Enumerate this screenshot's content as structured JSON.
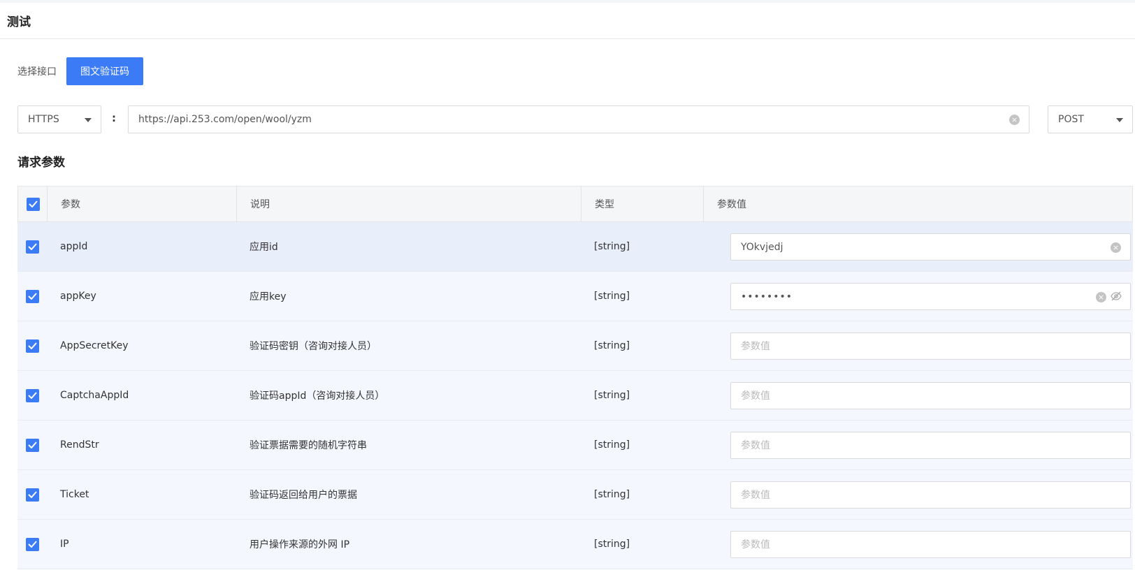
{
  "header": {
    "title": "测试"
  },
  "interface_select": {
    "label": "选择接口",
    "button": "图文验证码"
  },
  "request": {
    "protocol": "HTTPS",
    "separator": ":",
    "url": "https://api.253.com/open/wool/yzm",
    "method": "POST"
  },
  "params_section": {
    "title": "请求参数"
  },
  "table": {
    "headers": {
      "name": "参数",
      "desc": "说明",
      "type": "类型",
      "value": "参数值"
    },
    "rows": [
      {
        "name": "appId",
        "desc": "应用id",
        "type": "[string]",
        "value": "YOkvjedj",
        "placeholder": "参数值"
      },
      {
        "name": "appKey",
        "desc": "应用key",
        "type": "[string]",
        "value": "••••••••",
        "placeholder": "参数值"
      },
      {
        "name": "AppSecretKey",
        "desc": "验证码密钥（咨询对接人员）",
        "type": "[string]",
        "value": "",
        "placeholder": "参数值"
      },
      {
        "name": "CaptchaAppId",
        "desc": "验证码appId（咨询对接人员）",
        "type": "[string]",
        "value": "",
        "placeholder": "参数值"
      },
      {
        "name": "RendStr",
        "desc": "验证票据需要的随机字符串",
        "type": "[string]",
        "value": "",
        "placeholder": "参数值"
      },
      {
        "name": "Ticket",
        "desc": "验证码返回给用户的票据",
        "type": "[string]",
        "value": "",
        "placeholder": "参数值"
      },
      {
        "name": "IP",
        "desc": "用户操作来源的外网 IP",
        "type": "[string]",
        "value": "",
        "placeholder": "参数值"
      }
    ]
  },
  "colors": {
    "primary": "#3b7bf5",
    "row_bg": "#f5f7fe",
    "row_highlight": "#e9eefb"
  }
}
